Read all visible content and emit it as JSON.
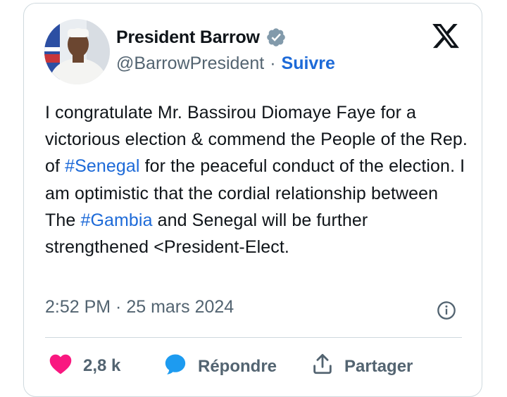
{
  "tweet": {
    "author": {
      "display_name": "President Barrow",
      "handle": "@BarrowPresident",
      "separator": "·",
      "follow_label": "Suivre",
      "verified_icon": "verified-badge-icon"
    },
    "text_parts": {
      "p1": "I congratulate Mr. Bassirou Diomaye Faye for a victorious election & commend the People of the Rep. of ",
      "hashtag1": "#Senegal",
      "p2": " for the peaceful conduct of the election. I am optimistic that the cordial relationship between The ",
      "hashtag2": "#Gambia",
      "p3": " and Senegal will be further strengthened <President-Elect."
    },
    "timestamp": "2:52 PM · 25 mars 2024",
    "actions": {
      "like_count": "2,8 k",
      "reply_label": "Répondre",
      "share_label": "Partager"
    }
  },
  "colors": {
    "link": "#1d6ad8",
    "muted": "#536471",
    "text": "#0f1419",
    "like": "#f91880",
    "verified": "#829aab",
    "border": "#cfd9de"
  },
  "icons": [
    "x-logo-icon",
    "verified-badge-icon",
    "info-icon",
    "heart-icon",
    "reply-bubble-icon",
    "share-icon"
  ]
}
